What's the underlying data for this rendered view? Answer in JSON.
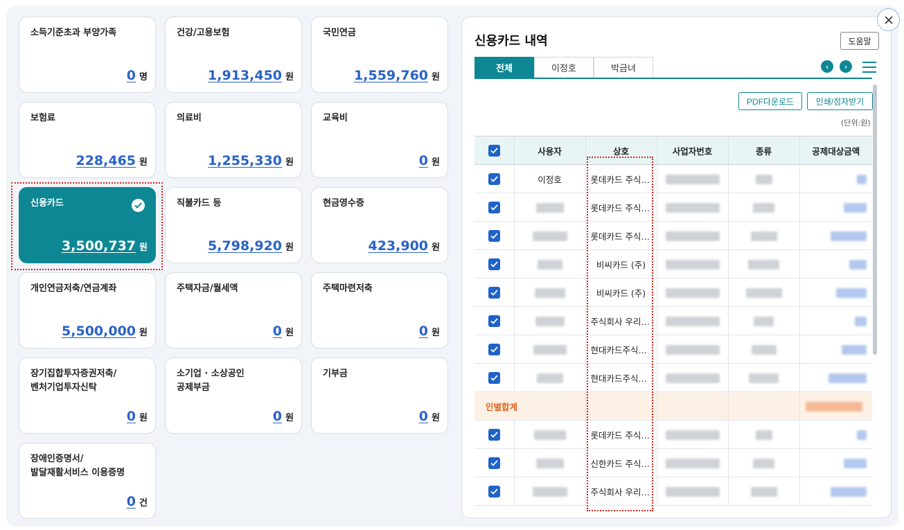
{
  "cards": [
    {
      "title": "소득기준초과 부양가족",
      "value": "0",
      "unit": "명"
    },
    {
      "title": "건강/고용보험",
      "value": "1,913,450",
      "unit": "원"
    },
    {
      "title": "국민연금",
      "value": "1,559,760",
      "unit": "원"
    },
    {
      "title": "보험료",
      "value": "228,465",
      "unit": "원"
    },
    {
      "title": "의료비",
      "value": "1,255,330",
      "unit": "원"
    },
    {
      "title": "교육비",
      "value": "0",
      "unit": "원"
    },
    {
      "title": "신용카드",
      "value": "3,500,737",
      "unit": "원"
    },
    {
      "title": "직불카드 등",
      "value": "5,798,920",
      "unit": "원"
    },
    {
      "title": "현금영수증",
      "value": "423,900",
      "unit": "원"
    },
    {
      "title": "개인연금저축/연금계좌",
      "value": "5,500,000",
      "unit": "원"
    },
    {
      "title": "주택자금/월세액",
      "value": "0",
      "unit": "원"
    },
    {
      "title": "주택마련저축",
      "value": "0",
      "unit": "원"
    },
    {
      "title": "장기집합투자증권저축/\n벤처기업투자신탁",
      "value": "0",
      "unit": "원"
    },
    {
      "title": "소기업 · 소상공인\n공제부금",
      "value": "0",
      "unit": "원"
    },
    {
      "title": "기부금",
      "value": "0",
      "unit": "원"
    },
    {
      "title": "장애인증명서/\n발달재활서비스 이용증명",
      "value": "0",
      "unit": "건"
    }
  ],
  "selected_card": "신용카드",
  "panel": {
    "title": "신용카드 내역",
    "help_label": "도움말",
    "tabs": [
      "전체",
      "이정호",
      "박금녀"
    ],
    "active_tab": "전체",
    "pdf_label": "PDF다운로드",
    "print_label": "인쇄/점자받기",
    "unit_note": "(단위:원)",
    "columns": [
      "사용자",
      "상호",
      "사업자번호",
      "종류",
      "공제대상금액"
    ],
    "rows": [
      {
        "user": "이정호",
        "store": "롯데카드 주식회사"
      },
      {
        "user": "",
        "store": "롯데카드 주식회사"
      },
      {
        "user": "",
        "store": "롯데카드 주식회사"
      },
      {
        "user": "",
        "store": "비씨카드 (주)"
      },
      {
        "user": "",
        "store": "비씨카드 (주)"
      },
      {
        "user": "",
        "store": "주식회사 우리카드"
      },
      {
        "user": "",
        "store": "현대카드주식회사"
      },
      {
        "user": "",
        "store": "현대카드주식회사"
      }
    ],
    "subtotal_label": "인별합계",
    "rows2": [
      {
        "user": "",
        "store": "롯데카드 주식회사"
      },
      {
        "user": "",
        "store": "신한카드 주식회사"
      },
      {
        "user": "",
        "store": "주식회사 우리카드"
      }
    ]
  },
  "icons": {
    "close": "close-icon",
    "check": "check-icon",
    "prev": "chevron-left-icon",
    "next": "chevron-right-icon",
    "menu": "menu-icon"
  },
  "colors": {
    "accent": "#0d8794",
    "link": "#2a63c6",
    "checkbox": "#1f63c9",
    "subtotal": "#e0641e",
    "highlight": "#d6201e"
  }
}
